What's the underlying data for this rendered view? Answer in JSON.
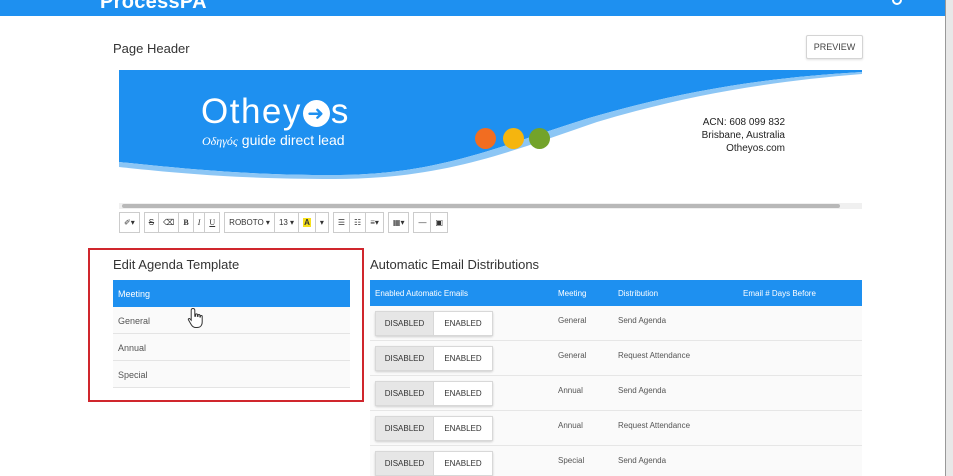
{
  "app": {
    "brand": "ProcessPA"
  },
  "page_header": {
    "title": "Page Header",
    "preview_label": "PREVIEW"
  },
  "banner": {
    "logo_part1": "Othey",
    "logo_arrow": "➜",
    "logo_part2": "s",
    "tagline_greek": "Οδηγός",
    "tagline": "guide direct lead",
    "contact_line1": "ACN: 608 099 832",
    "contact_line2": "Brisbane, Australia",
    "contact_line3": "Otheyos.com",
    "colors": {
      "primary": "#1e90f0",
      "dot_orange": "#f26d21",
      "dot_yellow": "#f5b50e",
      "dot_green": "#73a32a"
    }
  },
  "toolbar": {
    "magic": "✐▾",
    "strike": "S",
    "eraser": "⌫",
    "bold": "B",
    "underline": "U",
    "italic": "I",
    "font": "ROBOTO ▾",
    "size": "13 ▾",
    "color": "A",
    "color_caret": "▾",
    "ul": "☰",
    "ol": "☷",
    "align": "≡▾",
    "table": "▦▾",
    "hr": "—",
    "image": "▣"
  },
  "agenda": {
    "title": "Edit Agenda Template",
    "items": [
      "Meeting",
      "General",
      "Annual",
      "Special"
    ]
  },
  "email": {
    "title": "Automatic Email Distributions",
    "headers": [
      "Enabled Automatic Emails",
      "Meeting",
      "Distribution",
      "Email # Days Before"
    ],
    "disabled_label": "DISABLED",
    "enabled_label": "ENABLED",
    "rows": [
      {
        "meeting": "General",
        "distribution": "Send Agenda"
      },
      {
        "meeting": "General",
        "distribution": "Request Attendance"
      },
      {
        "meeting": "Annual",
        "distribution": "Send Agenda"
      },
      {
        "meeting": "Annual",
        "distribution": "Request Attendance"
      },
      {
        "meeting": "Special",
        "distribution": "Send Agenda"
      }
    ]
  }
}
